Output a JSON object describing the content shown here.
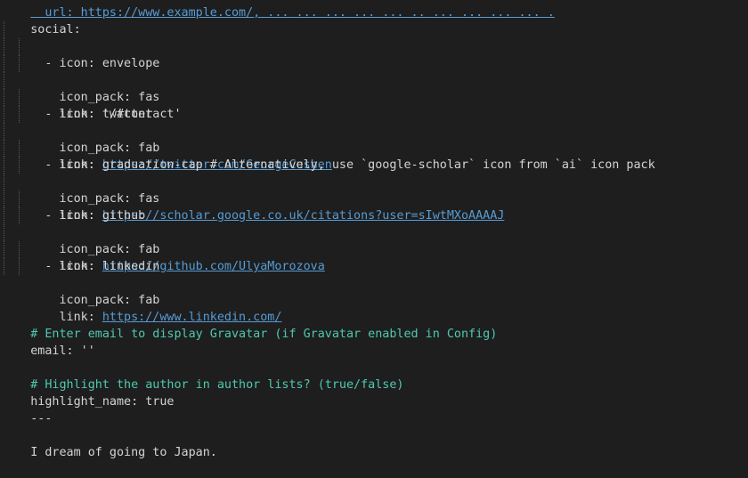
{
  "editor": {
    "lines": {
      "l0": {
        "text": "  url: https://www.example.com/, ... ... ... ... ... .. ... ... ... ... ."
      },
      "l1": {
        "key": "social:"
      },
      "items": [
        {
          "icon_line": "- icon: envelope",
          "pack_line": "icon_pack: fas",
          "link_key": "link: ",
          "link_value": "'/#contact'",
          "link_is_url": false
        },
        {
          "icon_line": "- icon: twitter",
          "pack_line": "icon_pack: fab",
          "link_key": "link: ",
          "link_value": "https://twitter.com/GeorgeCushen",
          "link_is_url": true
        },
        {
          "icon_line": "- icon: graduation-cap # Alternatively, use `google-scholar` icon from `ai` icon pack",
          "pack_line": "icon_pack: fas",
          "link_key": "link: ",
          "link_value": "https://scholar.google.co.uk/citations?user=sIwtMXoAAAAJ",
          "link_is_url": true
        },
        {
          "icon_line": "- icon: github",
          "pack_line": "icon_pack: fab",
          "link_key": "link: ",
          "link_value": "https://github.com/UlyaMorozova",
          "link_is_url": true
        },
        {
          "icon_line": "- icon: linkedin",
          "pack_line": "icon_pack: fab",
          "link_key": "link: ",
          "link_value": "https://www.linkedin.com/",
          "link_is_url": true
        }
      ],
      "comment_email": "# Enter email to display Gravatar (if Gravatar enabled in Config)",
      "email_line": "email: ''",
      "comment_highlight": "# Highlight the author in author lists? (true/false)",
      "highlight_line": "highlight_name: true",
      "front_matter_end": "---",
      "body_text": "I dream of going to Japan."
    }
  }
}
